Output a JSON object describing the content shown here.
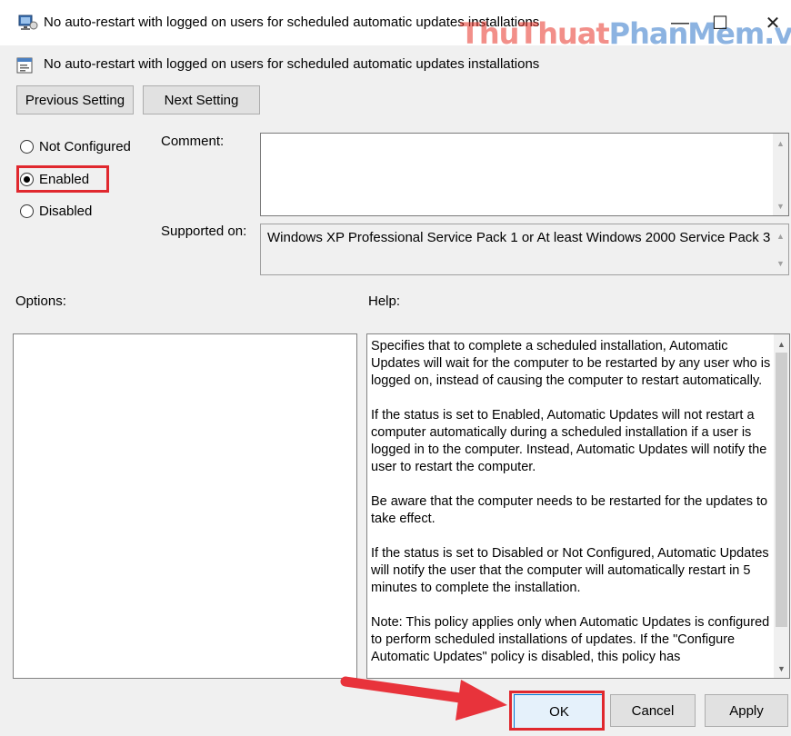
{
  "window": {
    "title": "No auto-restart with logged on users for scheduled automatic updates installations",
    "watermark_part1": "ThuThuat",
    "watermark_part2": "PhanMem",
    "watermark_part3": ".vn",
    "minimize_glyph": "—",
    "maximize_glyph": "☐",
    "close_glyph": "✕"
  },
  "header": {
    "policy_name": "No auto-restart with logged on users for scheduled automatic updates installations"
  },
  "nav": {
    "previous_label": "Previous Setting",
    "next_label": "Next Setting"
  },
  "state": {
    "options": [
      {
        "label": "Not Configured",
        "checked": false
      },
      {
        "label": "Enabled",
        "checked": true
      },
      {
        "label": "Disabled",
        "checked": false
      }
    ]
  },
  "comment": {
    "label": "Comment:",
    "value": ""
  },
  "supported": {
    "label": "Supported on:",
    "value": "Windows XP Professional Service Pack 1 or At least Windows 2000 Service Pack 3"
  },
  "options_panel": {
    "label": "Options:"
  },
  "help_panel": {
    "label": "Help:",
    "paragraphs": [
      "Specifies that to complete a scheduled installation, Automatic Updates will wait for the computer to be restarted by any user who is logged on, instead of causing the computer to restart automatically.",
      "If the status is set to Enabled, Automatic Updates will not restart a computer automatically during a scheduled installation if a user is logged in to the computer. Instead, Automatic Updates will notify the user to restart the computer.",
      "Be aware that the computer needs to be restarted for the updates to take effect.",
      "If the status is set to Disabled or Not Configured, Automatic Updates will notify the user that the computer will automatically restart in 5 minutes to complete the installation.",
      "Note: This policy applies only when Automatic Updates is configured to perform scheduled installations of updates. If the \"Configure Automatic Updates\" policy is disabled, this policy has"
    ]
  },
  "footer": {
    "ok_label": "OK",
    "cancel_label": "Cancel",
    "apply_label": "Apply"
  },
  "colors": {
    "highlight": "#e0282e",
    "window_bg": "#f0f0f0"
  }
}
